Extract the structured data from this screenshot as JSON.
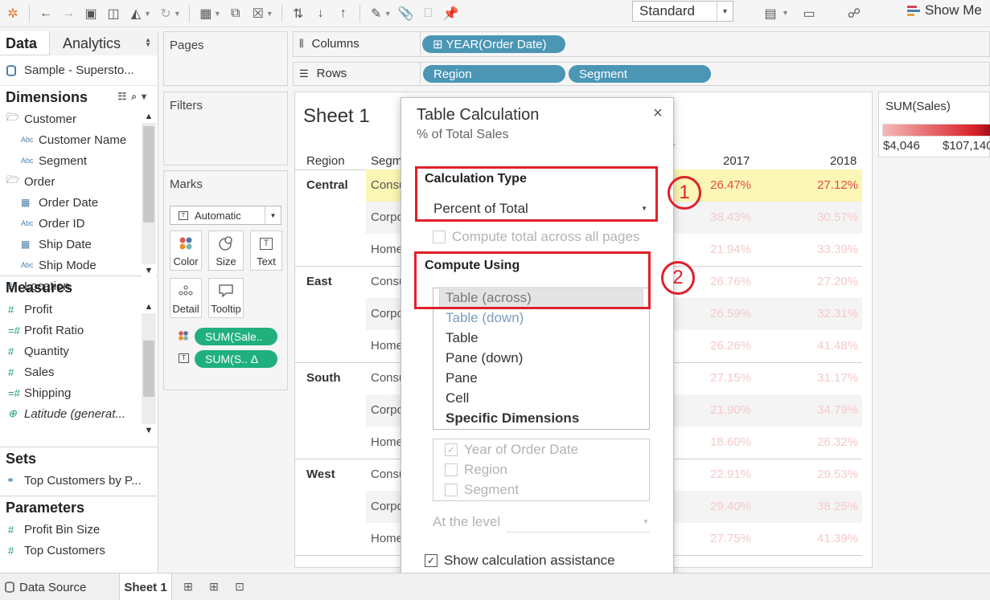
{
  "toolbar": {
    "standard_label": "Standard",
    "show_me_label": "Show Me"
  },
  "data_pane": {
    "tab_data": "Data",
    "tab_analytics": "Analytics",
    "datasource": "Sample - Supersto...",
    "dimensions_title": "Dimensions",
    "dimensions": [
      {
        "label": "Customer",
        "type": "folder"
      },
      {
        "label": "Customer Name",
        "type": "abc"
      },
      {
        "label": "Segment",
        "type": "abc"
      },
      {
        "label": "Order",
        "type": "folder"
      },
      {
        "label": "Order Date",
        "type": "date"
      },
      {
        "label": "Order ID",
        "type": "abc"
      },
      {
        "label": "Ship Date",
        "type": "date"
      },
      {
        "label": "Ship Mode",
        "type": "abc"
      },
      {
        "label": "Location",
        "type": "hierarchy"
      }
    ],
    "measures_title": "Measures",
    "measures": [
      {
        "label": "Profit"
      },
      {
        "label": "Profit Ratio"
      },
      {
        "label": "Quantity"
      },
      {
        "label": "Sales"
      },
      {
        "label": "Shipping"
      },
      {
        "label": "Latitude (generat..."
      }
    ],
    "sets_title": "Sets",
    "sets": [
      {
        "label": "Top Customers by P..."
      }
    ],
    "parameters_title": "Parameters",
    "parameters": [
      {
        "label": "Profit Bin Size"
      },
      {
        "label": "Top Customers"
      }
    ]
  },
  "cards": {
    "pages": "Pages",
    "filters": "Filters",
    "marks": "Marks",
    "marks_type": "Automatic",
    "mark_buttons": [
      "Color",
      "Size",
      "Text",
      "Detail",
      "Tooltip"
    ],
    "mark_pills": [
      "SUM(Sale..",
      "SUM(S.. Δ"
    ]
  },
  "shelves": {
    "columns_label": "Columns",
    "rows_label": "Rows",
    "columns_pills": [
      "⊞ YEAR(Order Date)"
    ],
    "rows_pills": [
      "Region",
      "Segment"
    ]
  },
  "view": {
    "title": "Sheet 1",
    "header_region": "Region",
    "header_segment": "Segm",
    "header_e": "e",
    "years": [
      "2017",
      "2018"
    ],
    "regions": [
      "Central",
      "East",
      "South",
      "West"
    ],
    "segments": [
      "Consu",
      "Corpo",
      "Home"
    ],
    "values_2017": [
      "26.47%",
      "38.43%",
      "21.94%",
      "26.76%",
      "26.59%",
      "26.26%",
      "27.15%",
      "21.90%",
      "18.60%",
      "22.91%",
      "29.40%",
      "27.75%"
    ],
    "values_2018": [
      "27.12%",
      "30.57%",
      "33.39%",
      "27.20%",
      "32.31%",
      "41.48%",
      "31.17%",
      "34.79%",
      "26.32%",
      "29.53%",
      "38.25%",
      "41.39%"
    ]
  },
  "legend": {
    "title": "SUM(Sales)",
    "low": "$4,046",
    "high": "$107,140",
    "ramp_low_color": "#f5b8b8",
    "ramp_high_color": "#a3101a"
  },
  "dialog": {
    "title": "Table Calculation",
    "subtitle": "% of Total Sales",
    "calc_type_label": "Calculation Type",
    "calc_type_value": "Percent of Total",
    "compute_total_label": "Compute total across all pages",
    "compute_using_label": "Compute Using",
    "options_overlay": [
      "Table (across)",
      "Table (down)"
    ],
    "options": [
      "Table",
      "Pane (down)",
      "Pane",
      "Cell",
      "Specific Dimensions"
    ],
    "dimensions": [
      "Year of Order Date",
      "Region",
      "Segment"
    ],
    "at_level_label": "At the level",
    "show_assist_label": "Show calculation assistance"
  },
  "annotations": {
    "one": "1",
    "two": "2",
    "color": "#e0202a"
  },
  "bottom": {
    "data_source": "Data Source",
    "sheet": "Sheet 1"
  }
}
